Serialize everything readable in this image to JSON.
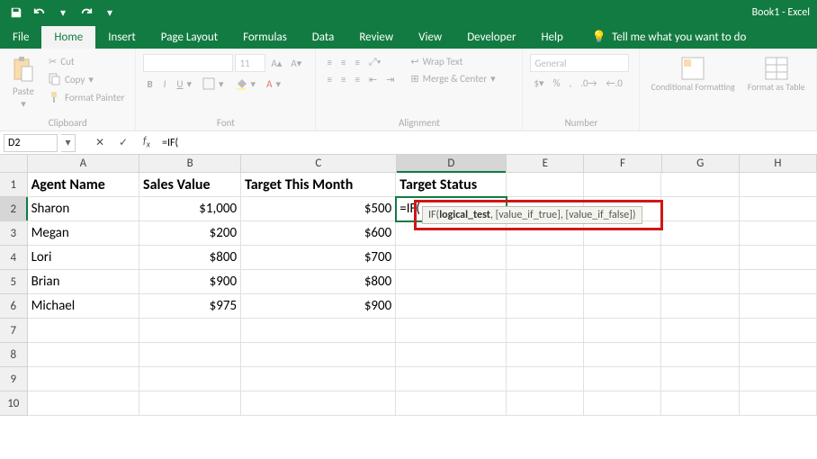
{
  "app": {
    "title": "Book1 - Excel"
  },
  "qat": {
    "save": "save",
    "undo": "undo",
    "redo": "redo"
  },
  "tabs": {
    "items": [
      "File",
      "Home",
      "Insert",
      "Page Layout",
      "Formulas",
      "Data",
      "Review",
      "View",
      "Developer",
      "Help"
    ],
    "active_index": 1,
    "tell_me": "Tell me what you want to do"
  },
  "ribbon": {
    "clipboard": {
      "paste": "Paste",
      "cut": "Cut",
      "copy": "Copy",
      "painter": "Format Painter",
      "label": "Clipboard"
    },
    "font": {
      "family": "",
      "size": "11",
      "bold": "B",
      "italic": "I",
      "underline": "U",
      "label": "Font"
    },
    "alignment": {
      "wrap": "Wrap Text",
      "merge": "Merge & Center",
      "label": "Alignment"
    },
    "number": {
      "format": "General",
      "label": "Number"
    },
    "styles": {
      "cond": "Conditional Formatting",
      "table": "Format as Table",
      "label": ""
    }
  },
  "namebox": {
    "value": "D2"
  },
  "formula_bar": {
    "value": "=IF("
  },
  "columns": [
    "A",
    "B",
    "C",
    "D",
    "E",
    "F",
    "G",
    "H"
  ],
  "row_labels": [
    "1",
    "2",
    "3",
    "4",
    "5",
    "6",
    "7",
    "8",
    "9",
    "10"
  ],
  "grid": {
    "headers": {
      "A": "Agent Name",
      "B": "Sales Value",
      "C": "Target This Month",
      "D": "Target Status"
    },
    "rows": [
      {
        "A": "Sharon",
        "B": "$1,000",
        "C": "$500"
      },
      {
        "A": "Megan",
        "B": "$200",
        "C": "$600"
      },
      {
        "A": "Lori",
        "B": "$800",
        "C": "$700"
      },
      {
        "A": "Brian",
        "B": "$900",
        "C": "$800"
      },
      {
        "A": "Michael",
        "B": "$975",
        "C": "$900"
      }
    ],
    "editing": {
      "cell": "D2",
      "text": "=IF("
    }
  },
  "hint": {
    "prefix": "IF(",
    "bold": "logical_test",
    "suffix": ", [value_if_true], [value_if_false])"
  }
}
